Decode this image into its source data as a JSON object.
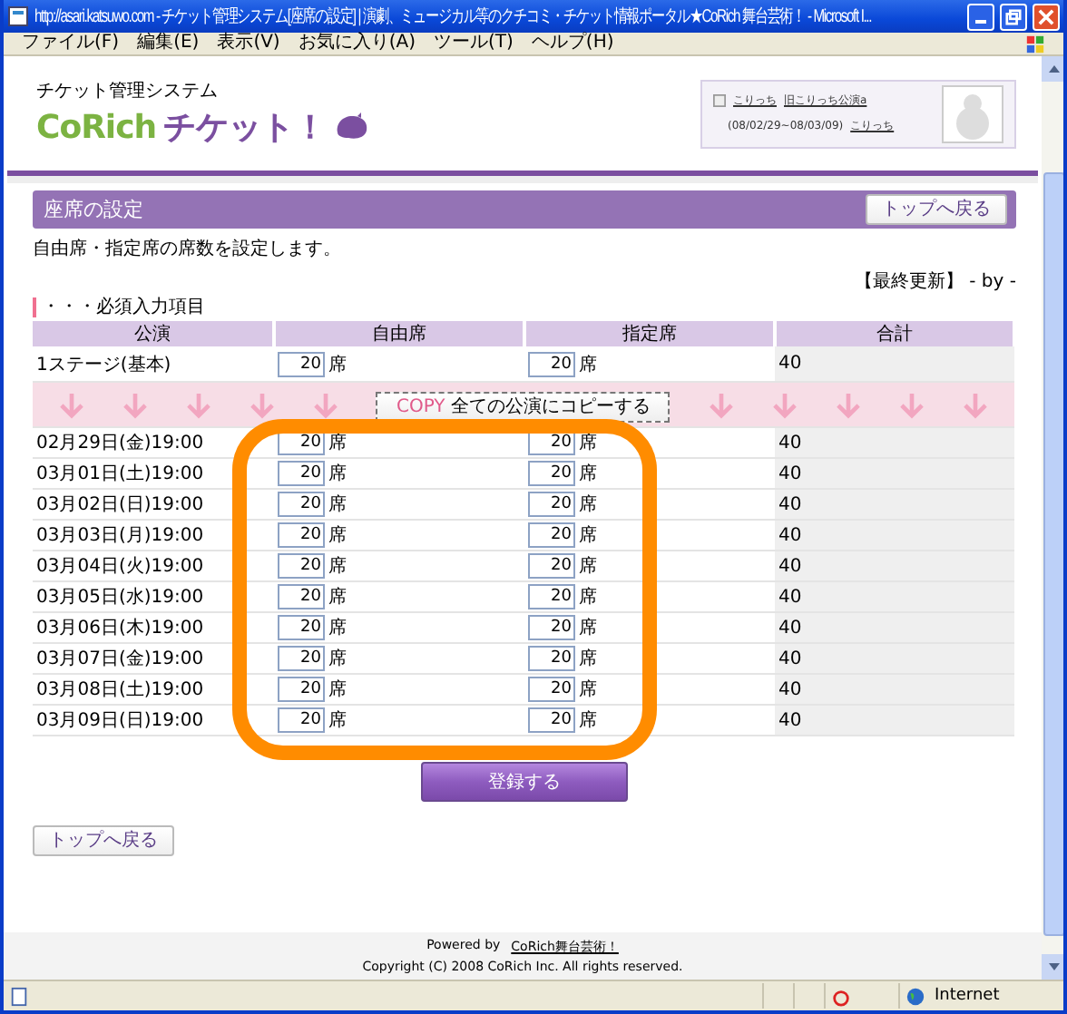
{
  "window": {
    "title": "http://asari.katsuwo.com - チケット管理システム[座席の設定] | 演劇、ミュージカル等のクチコミ・チケット情報ポータル★CoRich 舞台芸術！ - Microsoft I..."
  },
  "menu": [
    "ファイル(F)",
    "編集(E)",
    "表示(V)",
    "お気に入り(A)",
    "ツール(T)",
    "ヘルプ(H)"
  ],
  "header": {
    "subtitle": "チケット管理システム",
    "logo_latin": "CoRich",
    "logo_kana": "チケット！",
    "links": [
      "こりっち",
      "旧こりっち公演a"
    ],
    "period": "(08/02/29~08/03/09)",
    "link2": "こりっち"
  },
  "section": {
    "title": "座席の設定",
    "back": "トップへ戻る"
  },
  "description": "自由席・指定席の席数を設定します。",
  "updated": "【最終更新】 - by -",
  "required_note": "・・・必須入力項目",
  "table": {
    "columns": [
      "公演",
      "自由席",
      "指定席",
      "合計"
    ],
    "base": {
      "name": "1ステージ(基本)",
      "free": "20",
      "free_unit": "席",
      "reserved": "20",
      "reserved_unit": "席",
      "total": "40"
    },
    "copy": {
      "tag": "COPY",
      "label": "全ての公演にコピーする"
    },
    "rows": [
      {
        "date": "02月29日(金)19:00",
        "free": "20",
        "free_unit": "席",
        "reserved": "20",
        "reserved_unit": "席",
        "total": "40"
      },
      {
        "date": "03月01日(土)19:00",
        "free": "20",
        "free_unit": "席",
        "reserved": "20",
        "reserved_unit": "席",
        "total": "40"
      },
      {
        "date": "03月02日(日)19:00",
        "free": "20",
        "free_unit": "席",
        "reserved": "20",
        "reserved_unit": "席",
        "total": "40"
      },
      {
        "date": "03月03日(月)19:00",
        "free": "20",
        "free_unit": "席",
        "reserved": "20",
        "reserved_unit": "席",
        "total": "40"
      },
      {
        "date": "03月04日(火)19:00",
        "free": "20",
        "free_unit": "席",
        "reserved": "20",
        "reserved_unit": "席",
        "total": "40"
      },
      {
        "date": "03月05日(水)19:00",
        "free": "20",
        "free_unit": "席",
        "reserved": "20",
        "reserved_unit": "席",
        "total": "40"
      },
      {
        "date": "03月06日(木)19:00",
        "free": "20",
        "free_unit": "席",
        "reserved": "20",
        "reserved_unit": "席",
        "total": "40"
      },
      {
        "date": "03月07日(金)19:00",
        "free": "20",
        "free_unit": "席",
        "reserved": "20",
        "reserved_unit": "席",
        "total": "40"
      },
      {
        "date": "03月08日(土)19:00",
        "free": "20",
        "free_unit": "席",
        "reserved": "20",
        "reserved_unit": "席",
        "total": "40"
      },
      {
        "date": "03月09日(日)19:00",
        "free": "20",
        "free_unit": "席",
        "reserved": "20",
        "reserved_unit": "席",
        "total": "40"
      }
    ]
  },
  "submit": "登録する",
  "back_bottom": "トップへ戻る",
  "footer": {
    "powered": "Powered by",
    "link": "CoRich舞台芸術！",
    "copyright": "Copyright (C) 2008 CoRich Inc. All rights reserved."
  },
  "status_bar": {
    "zone": "Internet"
  }
}
